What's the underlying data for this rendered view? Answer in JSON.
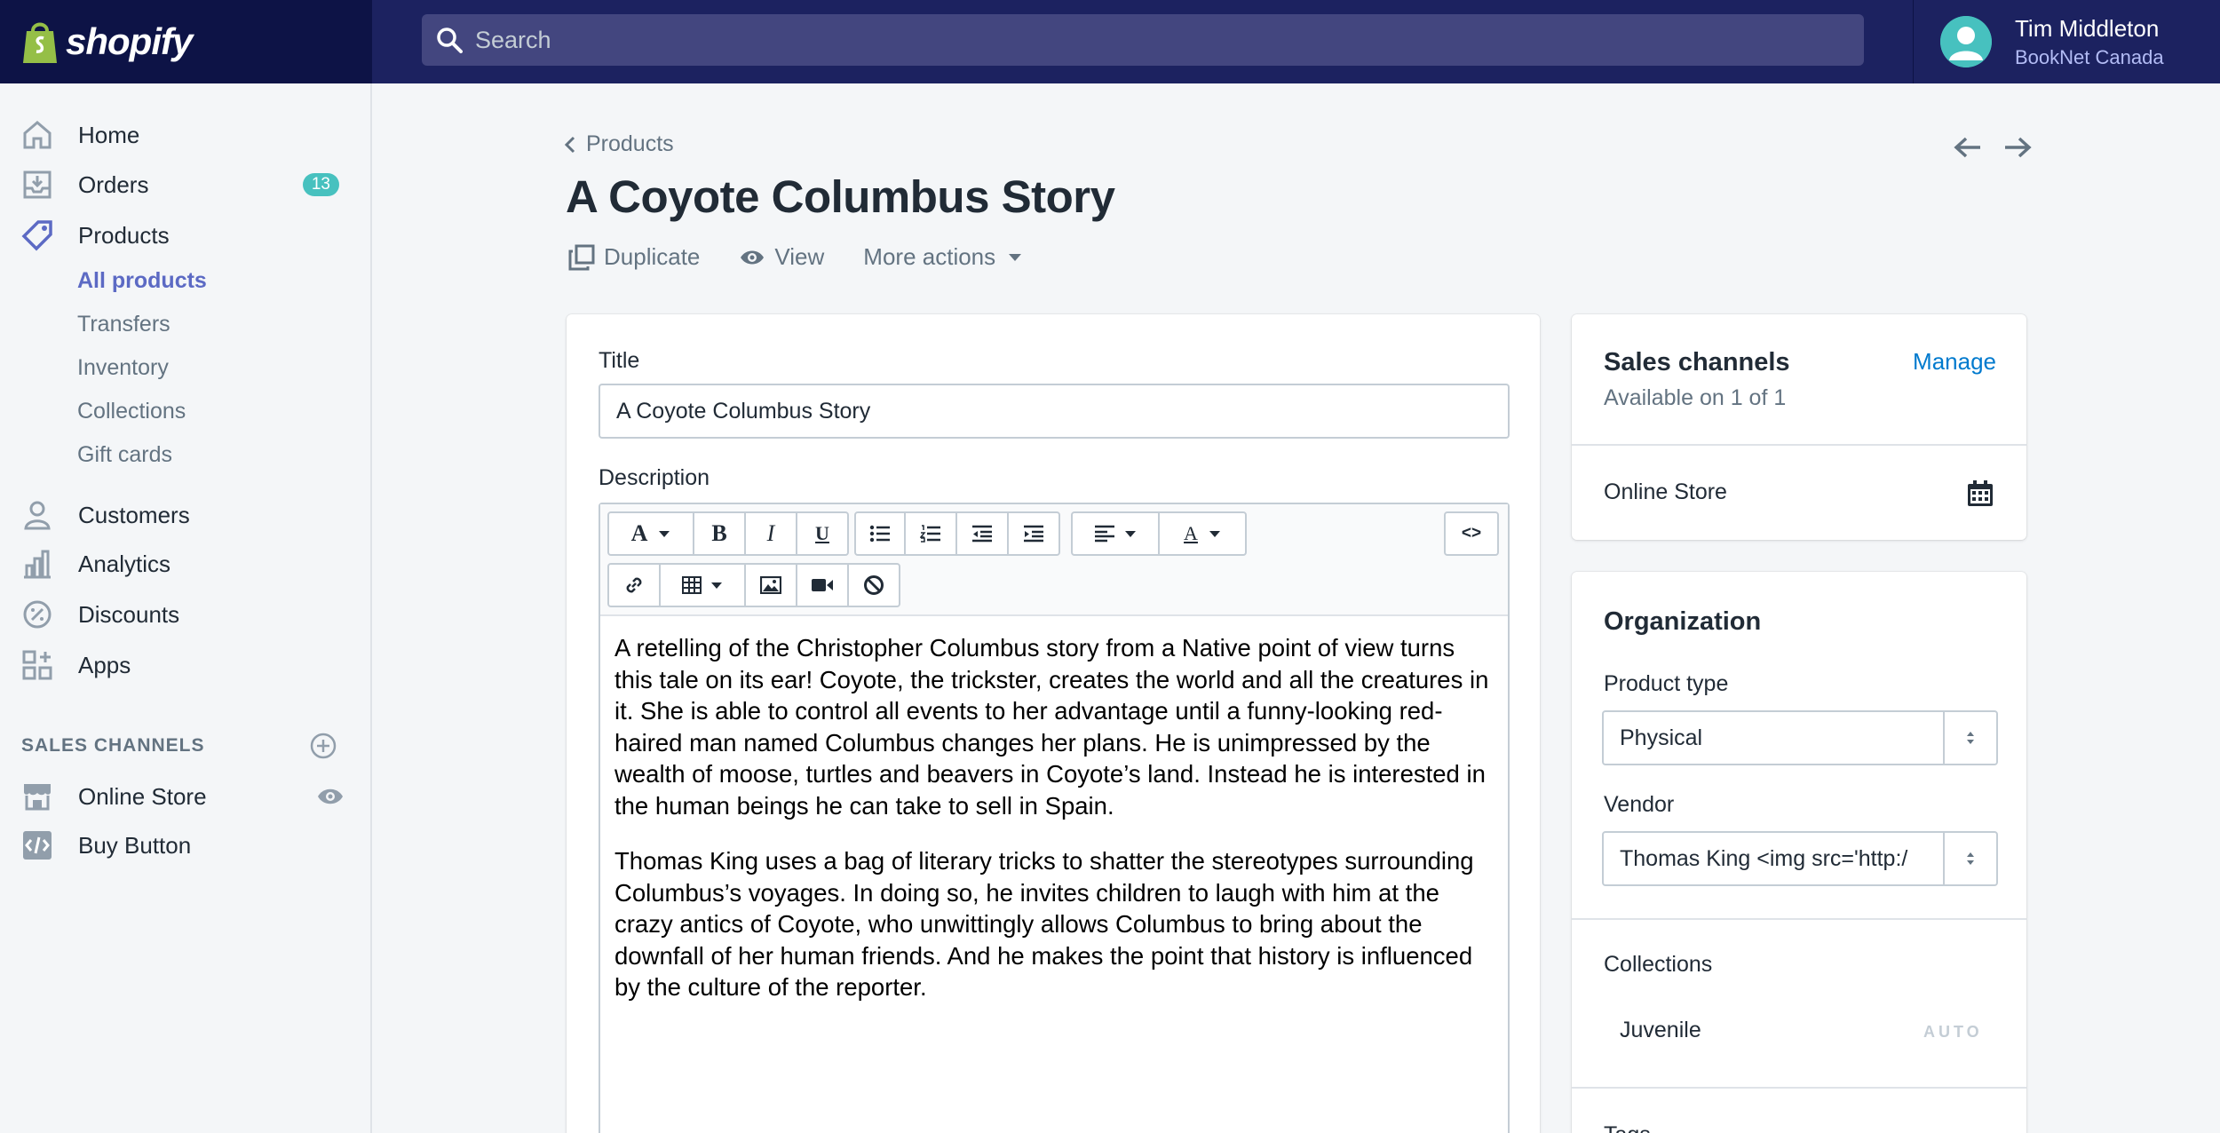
{
  "brand": {
    "name": "shopify"
  },
  "search": {
    "placeholder": "Search"
  },
  "user": {
    "name": "Tim Middleton",
    "shop": "BookNet Canada"
  },
  "sidebar": {
    "items": [
      {
        "label": "Home",
        "icon": "home-icon"
      },
      {
        "label": "Orders",
        "icon": "orders-icon",
        "badge": "13"
      },
      {
        "label": "Products",
        "icon": "products-tag-icon"
      },
      {
        "label": "Customers",
        "icon": "customers-icon"
      },
      {
        "label": "Analytics",
        "icon": "analytics-icon"
      },
      {
        "label": "Discounts",
        "icon": "discounts-icon"
      },
      {
        "label": "Apps",
        "icon": "apps-icon"
      }
    ],
    "product_sub": [
      "All products",
      "Transfers",
      "Inventory",
      "Collections",
      "Gift cards"
    ],
    "sales_channels_heading": "SALES CHANNELS",
    "channels": [
      {
        "label": "Online Store",
        "icon": "online-store-icon"
      },
      {
        "label": "Buy Button",
        "icon": "buy-button-icon"
      }
    ]
  },
  "breadcrumb": {
    "label": "Products"
  },
  "page": {
    "title": "A Coyote Columbus Story",
    "actions": {
      "duplicate": "Duplicate",
      "view": "View",
      "more": "More actions"
    }
  },
  "form": {
    "title_label": "Title",
    "title_value": "A Coyote Columbus Story",
    "description_label": "Description",
    "description_paragraphs": [
      "A retelling of the Christopher Columbus story from a Native point of view turns this tale on its ear! Coyote, the trickster, creates the world and all the creatures in it. She is able to control all events to her advantage until a funny-looking red-haired man named Columbus changes her plans. He is unimpressed by the wealth of moose, turtles and beavers in Coyote’s land. Instead he is interested in the human beings he can take to sell in Spain.",
      "Thomas King uses a bag of literary tricks to shatter the stereotypes surrounding Columbus’s voyages. In doing so, he invites children to laugh with him at the crazy antics of Coyote, who unwittingly allows Columbus to bring about the downfall of her human friends. And he makes the point that history is influenced by the culture of the reporter."
    ],
    "toolbar": {
      "html_toggle": "<>"
    }
  },
  "sales_channels": {
    "title": "Sales channels",
    "manage": "Manage",
    "availability": "Available on 1 of 1",
    "channel": "Online Store"
  },
  "organization": {
    "title": "Organization",
    "product_type_label": "Product type",
    "product_type_value": "Physical",
    "vendor_label": "Vendor",
    "vendor_value": "Thomas King <img src='http:/",
    "collections_label": "Collections",
    "collection_item": "Juvenile",
    "collection_auto": "AUTO",
    "tags_label": "Tags"
  },
  "colors": {
    "topbar": "#1c2260",
    "brand_bg": "#0d1346",
    "accent": "#5c6ac4",
    "badge": "#47c1bf",
    "link": "#007ace"
  }
}
